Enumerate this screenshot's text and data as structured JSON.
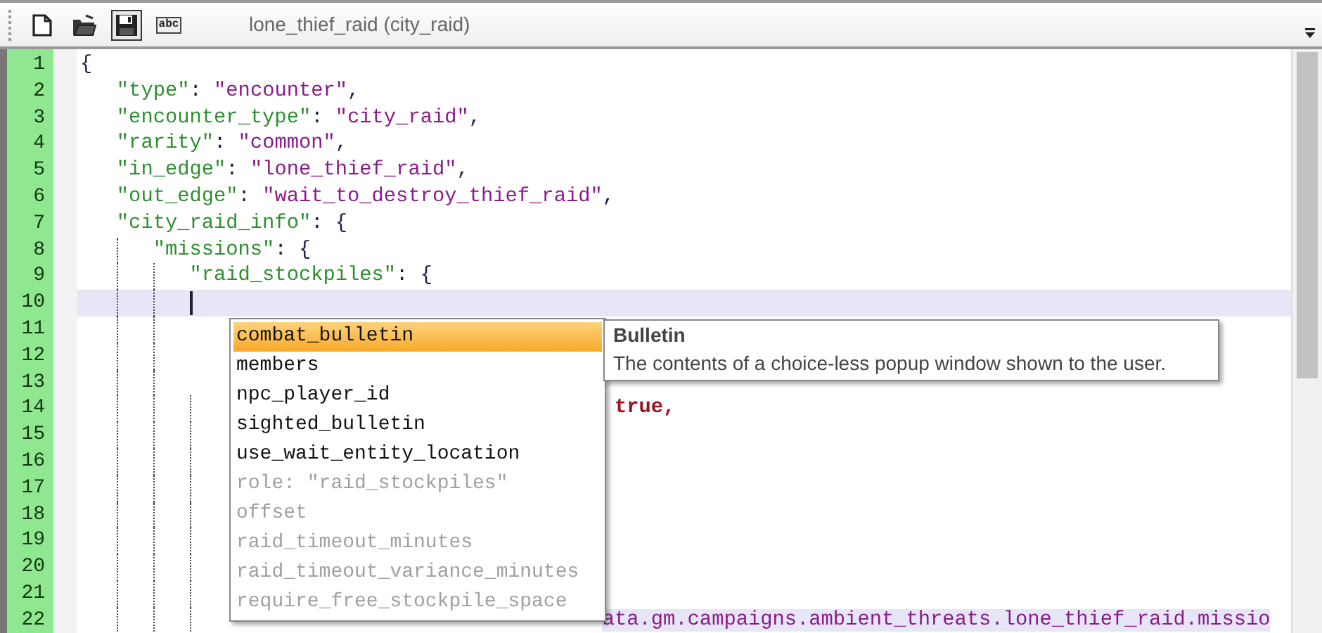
{
  "toolbar": {
    "buttons": [
      {
        "kind": "new",
        "pressed": false
      },
      {
        "kind": "open",
        "pressed": false
      },
      {
        "kind": "save",
        "pressed": true
      },
      {
        "kind": "spell",
        "label": "abc",
        "pressed": false
      }
    ],
    "title": "lone_thief_raid (city_raid)"
  },
  "editor": {
    "lines": [
      {
        "number": "1",
        "current": false,
        "tokens": [
          {
            "kind": "punct",
            "text": "{"
          }
        ]
      },
      {
        "number": "2",
        "current": false,
        "tokens": [
          {
            "kind": "key",
            "text": "   \"type\""
          },
          {
            "kind": "punct",
            "text": ": "
          },
          {
            "kind": "string",
            "text": "\"encounter\""
          },
          {
            "kind": "punct",
            "text": ","
          }
        ]
      },
      {
        "number": "3",
        "current": false,
        "tokens": [
          {
            "kind": "key",
            "text": "   \"encounter_type\""
          },
          {
            "kind": "punct",
            "text": ": "
          },
          {
            "kind": "string",
            "text": "\"city_raid\""
          },
          {
            "kind": "punct",
            "text": ","
          }
        ]
      },
      {
        "number": "4",
        "current": false,
        "tokens": [
          {
            "kind": "key",
            "text": "   \"rarity\""
          },
          {
            "kind": "punct",
            "text": ": "
          },
          {
            "kind": "string",
            "text": "\"common\""
          },
          {
            "kind": "punct",
            "text": ","
          }
        ]
      },
      {
        "number": "5",
        "current": false,
        "tokens": [
          {
            "kind": "key",
            "text": "   \"in_edge\""
          },
          {
            "kind": "punct",
            "text": ": "
          },
          {
            "kind": "string",
            "text": "\"lone_thief_raid\""
          },
          {
            "kind": "punct",
            "text": ","
          }
        ]
      },
      {
        "number": "6",
        "current": false,
        "tokens": [
          {
            "kind": "key",
            "text": "   \"out_edge\""
          },
          {
            "kind": "punct",
            "text": ": "
          },
          {
            "kind": "string",
            "text": "\"wait_to_destroy_thief_raid\""
          },
          {
            "kind": "punct",
            "text": ","
          }
        ]
      },
      {
        "number": "7",
        "current": false,
        "tokens": [
          {
            "kind": "key",
            "text": "   \"city_raid_info\""
          },
          {
            "kind": "punct",
            "text": ": {"
          }
        ]
      },
      {
        "number": "8",
        "current": false,
        "tokens": [
          {
            "kind": "key",
            "text": "      \"missions\""
          },
          {
            "kind": "punct",
            "text": ": {"
          }
        ]
      },
      {
        "number": "9",
        "current": false,
        "tokens": [
          {
            "kind": "key",
            "text": "         \"raid_stockpiles\""
          },
          {
            "kind": "punct",
            "text": ": {"
          }
        ]
      },
      {
        "number": "10",
        "current": true
      },
      {
        "number": "11",
        "current": false
      },
      {
        "number": "12",
        "current": false
      },
      {
        "number": "13",
        "current": false
      },
      {
        "number": "14",
        "current": false,
        "tokens": [
          {
            "kind": "bool",
            "text": "                                            true,"
          }
        ]
      },
      {
        "number": "15",
        "current": false
      },
      {
        "number": "16",
        "current": false
      },
      {
        "number": "17",
        "current": false
      },
      {
        "number": "18",
        "current": false
      },
      {
        "number": "19",
        "current": false
      },
      {
        "number": "20",
        "current": false
      },
      {
        "number": "21",
        "current": false
      },
      {
        "number": "22",
        "current": false,
        "tokens": [
          {
            "kind": "highlight",
            "text": "                                           ata.gm.campaigns.ambient_threats.lone_thief_raid.missio"
          }
        ]
      }
    ]
  },
  "completion": {
    "items": [
      {
        "label": "combat_bulletin",
        "selected": true,
        "enabled": true
      },
      {
        "label": "members",
        "selected": false,
        "enabled": true
      },
      {
        "label": "npc_player_id",
        "selected": false,
        "enabled": true
      },
      {
        "label": "sighted_bulletin",
        "selected": false,
        "enabled": true
      },
      {
        "label": "use_wait_entity_location",
        "selected": false,
        "enabled": true
      },
      {
        "label": "role: \"raid_stockpiles\"",
        "selected": false,
        "enabled": false
      },
      {
        "label": "offset",
        "selected": false,
        "enabled": false
      },
      {
        "label": "raid_timeout_minutes",
        "selected": false,
        "enabled": false
      },
      {
        "label": "raid_timeout_variance_minutes",
        "selected": false,
        "enabled": false
      },
      {
        "label": "require_free_stockpile_space",
        "selected": false,
        "enabled": false
      }
    ],
    "tooltip": {
      "title": "Bulletin",
      "text": "The contents of a choice-less popup window shown to the user."
    }
  }
}
